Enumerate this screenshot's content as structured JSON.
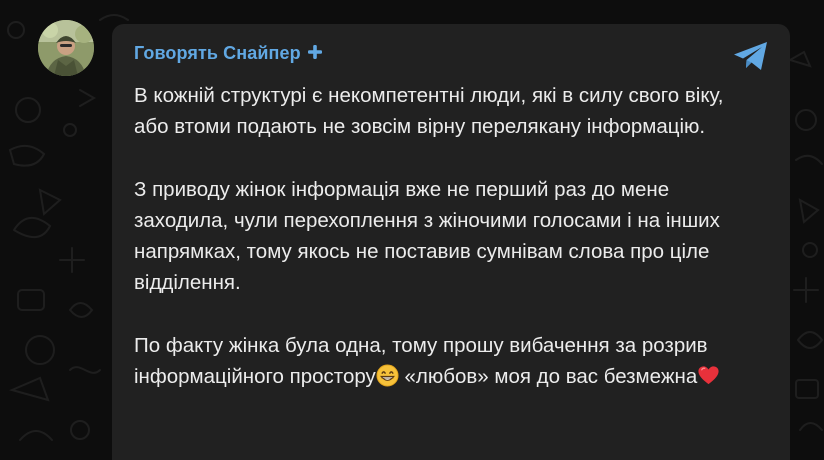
{
  "message": {
    "sender": "Говорять Снайпер",
    "sender_color": "#61a8e3",
    "badge_icon": "plus-icon",
    "channel_icon": "telegram-icon",
    "paragraphs": {
      "p1": "В кожній структурі є некомпетентні люди, які в силу свого віку, або втоми подають не зовсім вірну перелякану інформацію.",
      "p2": "З приводу жінок інформація вже не перший раз до мене заходила, чули перехоплення з жіночими голосами і на інших напрямках, тому якось не поставив сумнівам слова про ціле відділення.",
      "p3_before_emoji": "По факту жінка була одна, тому прошу вибачення за розрив інформаційного простору",
      "p3_after_emoji": " «любов» моя до вас безмежна"
    },
    "emojis": [
      "grinning-face-icon",
      "red-heart-icon"
    ]
  },
  "colors": {
    "bubble": "#212121",
    "background": "#0d0d0d",
    "text": "#ececec",
    "accent": "#61a8e3"
  }
}
